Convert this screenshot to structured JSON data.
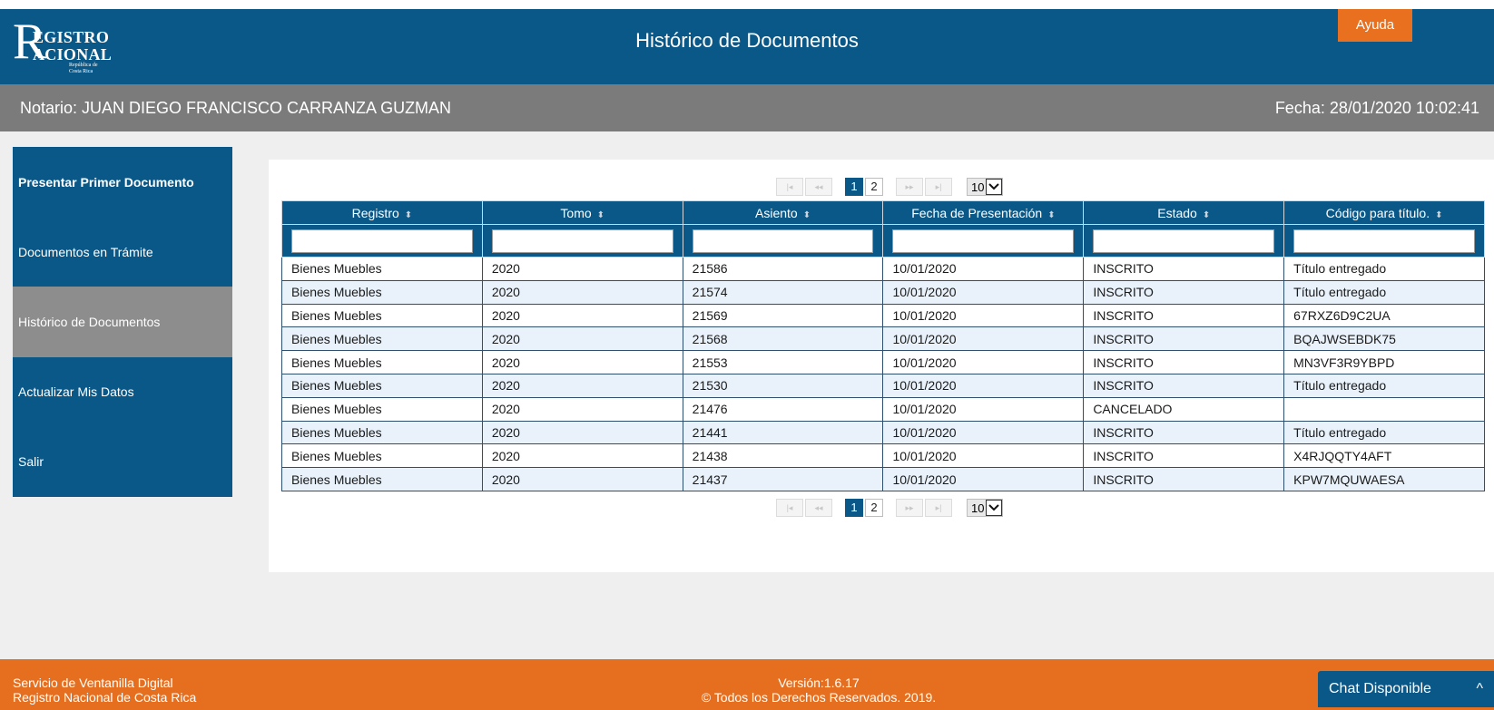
{
  "header": {
    "logo_r": "R",
    "logo_line1": "EGISTRO",
    "logo_line2": "ACIONAL",
    "logo_small": "República de Costa Rica",
    "title": "Histórico de Documentos",
    "help_label": "Ayuda"
  },
  "infobar": {
    "notario": "Notario: JUAN DIEGO FRANCISCO CARRANZA GUZMAN",
    "fecha": "Fecha: 28/01/2020 10:02:41"
  },
  "sidebar": {
    "items": [
      {
        "label": "Presentar Primer Documento"
      },
      {
        "label": "Documentos en Trámite"
      },
      {
        "label": "Histórico de Documentos"
      },
      {
        "label": "Actualizar Mis Datos"
      },
      {
        "label": "Salir"
      }
    ]
  },
  "pager": {
    "first": "|◂",
    "prev": "◂◂",
    "next": "▸▸",
    "last": "▸|",
    "pages": [
      "1",
      "2"
    ],
    "current_page": "1",
    "page_size": "10"
  },
  "table": {
    "columns": [
      "Registro",
      "Tomo",
      "Asiento",
      "Fecha de Presentación",
      "Estado",
      "Código para título."
    ],
    "sort_icon": "⬍",
    "rows": [
      [
        "Bienes Muebles",
        "2020",
        "21586",
        "10/01/2020",
        "INSCRITO",
        "Título entregado"
      ],
      [
        "Bienes Muebles",
        "2020",
        "21574",
        "10/01/2020",
        "INSCRITO",
        "Título entregado"
      ],
      [
        "Bienes Muebles",
        "2020",
        "21569",
        "10/01/2020",
        "INSCRITO",
        "67RXZ6D9C2UA"
      ],
      [
        "Bienes Muebles",
        "2020",
        "21568",
        "10/01/2020",
        "INSCRITO",
        "BQAJWSEBDK75"
      ],
      [
        "Bienes Muebles",
        "2020",
        "21553",
        "10/01/2020",
        "INSCRITO",
        "MN3VF3R9YBPD"
      ],
      [
        "Bienes Muebles",
        "2020",
        "21530",
        "10/01/2020",
        "INSCRITO",
        "Título entregado"
      ],
      [
        "Bienes Muebles",
        "2020",
        "21476",
        "10/01/2020",
        "CANCELADO",
        ""
      ],
      [
        "Bienes Muebles",
        "2020",
        "21441",
        "10/01/2020",
        "INSCRITO",
        "Título entregado"
      ],
      [
        "Bienes Muebles",
        "2020",
        "21438",
        "10/01/2020",
        "INSCRITO",
        "X4RJQQTY4AFT"
      ],
      [
        "Bienes Muebles",
        "2020",
        "21437",
        "10/01/2020",
        "INSCRITO",
        "KPW7MQUWAESA"
      ]
    ]
  },
  "footer": {
    "left_line1": "Servicio de Ventanilla Digital",
    "left_line2": "Registro Nacional de Costa Rica",
    "version": "Versión:1.6.17",
    "copyright": "© Todos los Derechos Reservados. 2019."
  },
  "chat": {
    "label": "Chat Disponible",
    "icon": "^"
  },
  "colors": {
    "primary": "#0a5888",
    "accent": "#e66f1f",
    "gray_bar": "#7b7b7b",
    "active_side": "#8d8d8d",
    "row_alt": "#e9f2fb"
  }
}
